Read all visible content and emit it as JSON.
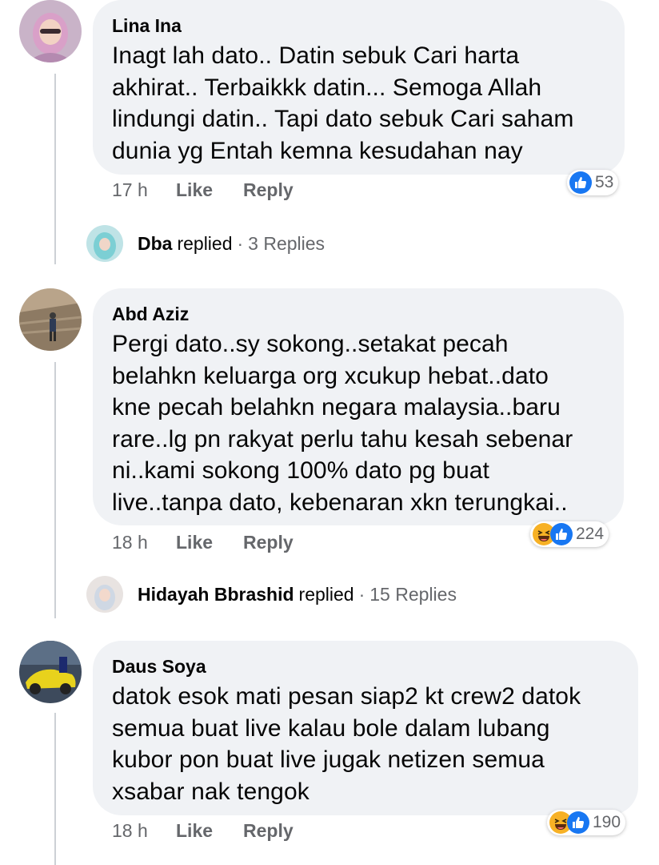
{
  "comments": [
    {
      "author": "Lina Ina",
      "lines": [
        "Inagt lah dato.. Datin sebuk Cari harta",
        "akhirat.. Terbaikkk datin... Semoga Allah",
        "lindungi datin.. Tapi dato sebuk Cari saham",
        "dunia yg Entah kemna kesudahan nay"
      ],
      "time": "17 h",
      "like_label": "Like",
      "reply_label": "Reply",
      "reaction_count": "53",
      "reaction_types": [
        "like"
      ],
      "replies": {
        "name": "Dba",
        "verb": "replied",
        "separator": "·",
        "count_label": "3 Replies"
      }
    },
    {
      "author": "Abd Aziz",
      "lines": [
        "Pergi dato..sy sokong..setakat pecah",
        "belahkn keluarga org xcukup hebat..dato",
        "kne pecah belahkn negara malaysia..baru",
        "rare..lg pn rakyat perlu tahu kesah sebenar",
        "ni..kami sokong 100% dato pg buat",
        "live..tanpa dato, kebenaran xkn terungkai.."
      ],
      "time": "18 h",
      "like_label": "Like",
      "reply_label": "Reply",
      "reaction_count": "224",
      "reaction_types": [
        "haha",
        "like"
      ],
      "replies": {
        "name": "Hidayah Bbrashid",
        "verb": "replied",
        "separator": "·",
        "count_label": "15 Replies"
      }
    },
    {
      "author": "Daus Soya",
      "lines": [
        "datok esok mati pesan siap2 kt crew2 datok",
        "semua buat live kalau bole dalam lubang",
        "kubor pon buat live jugak netizen semua",
        "xsabar nak tengok"
      ],
      "time": "18 h",
      "like_label": "Like",
      "reply_label": "Reply",
      "reaction_count": "190",
      "reaction_types": [
        "haha",
        "like"
      ]
    }
  ],
  "colors": {
    "like_blue": "#1877f2",
    "haha_yellow": "#f7b125",
    "bubble_bg": "#f0f2f5",
    "meta_gray": "#65676b"
  }
}
